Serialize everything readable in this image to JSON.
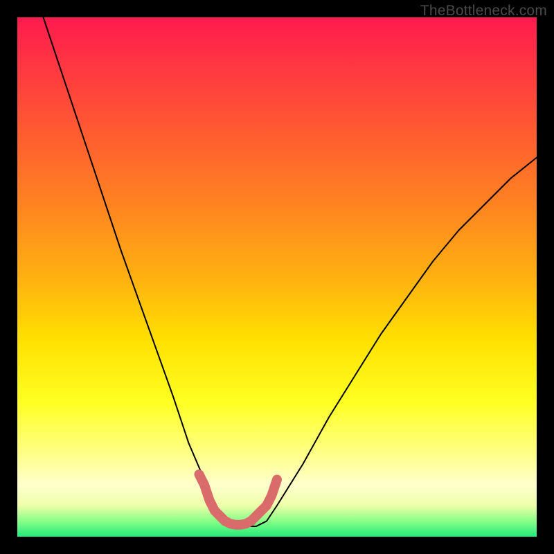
{
  "watermark": "TheBottleneck.com",
  "chart_data": {
    "type": "line",
    "title": "",
    "xlabel": "",
    "ylabel": "",
    "xlim": [
      0,
      100
    ],
    "ylim": [
      0,
      100
    ],
    "series": [
      {
        "name": "bottleneck-curve",
        "x": [
          5,
          10,
          15,
          20,
          25,
          30,
          33,
          36,
          38,
          40,
          42,
          44,
          46,
          48,
          50,
          55,
          60,
          65,
          70,
          75,
          80,
          85,
          90,
          95,
          100
        ],
        "values": [
          100,
          85,
          70,
          55,
          41,
          27,
          18,
          11,
          6,
          3,
          2,
          2,
          2,
          3,
          6,
          14,
          23,
          31,
          39,
          46,
          53,
          59,
          64,
          69,
          73
        ]
      }
    ],
    "highlight": {
      "name": "optimum-band",
      "color": "#d96b6b",
      "x": [
        35,
        36,
        37,
        38,
        39,
        40,
        41,
        42,
        43,
        44,
        45,
        46,
        47,
        48,
        49,
        50
      ],
      "values": [
        12,
        10,
        7,
        5,
        4,
        3,
        2.5,
        2.3,
        2.3,
        2.5,
        3,
        4,
        5,
        6,
        8,
        11
      ]
    }
  }
}
